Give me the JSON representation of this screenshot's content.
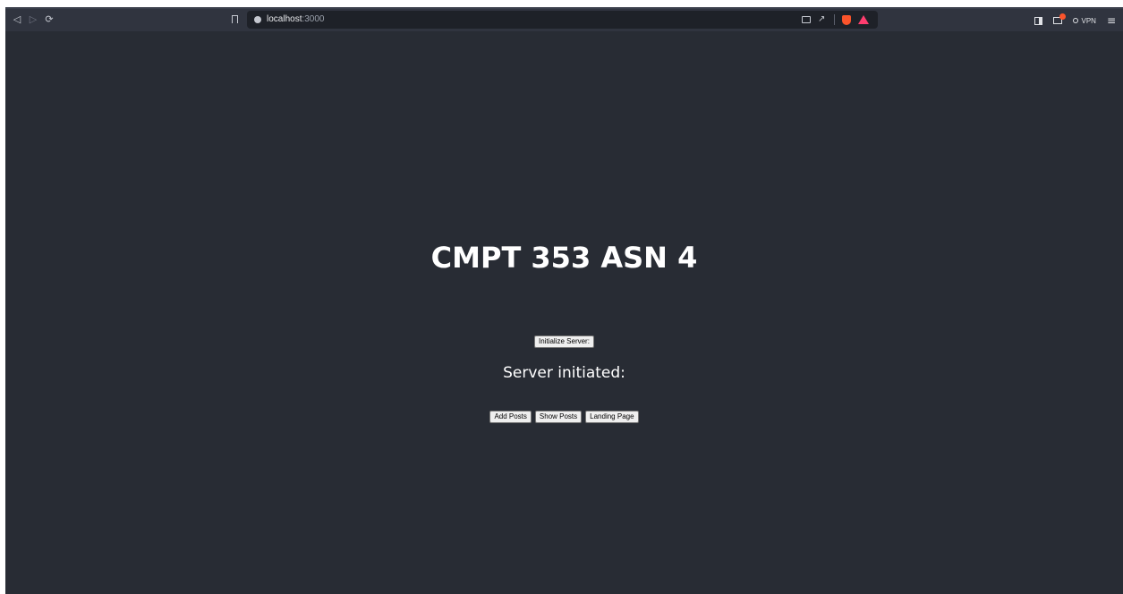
{
  "browser": {
    "url_host": "localhost",
    "url_port": ":3000",
    "vpn_label": "VPN",
    "icons": {
      "back": "back-arrow-icon",
      "forward": "forward-arrow-icon",
      "reload": "reload-icon",
      "bookmark": "bookmark-icon",
      "site_info": "site-info-icon",
      "cast": "cast-icon",
      "share": "share-icon",
      "brave_shield": "brave-shield-icon",
      "brave_rewards": "brave-rewards-icon",
      "sidebar": "sidebar-icon",
      "wallet": "wallet-icon",
      "menu": "menu-icon"
    },
    "colors": {
      "toolbar": "#30343f",
      "urlbar": "#1e2128",
      "page_background": "#282c34",
      "brave_orange": "#fb542b"
    }
  },
  "page": {
    "title": "CMPT 353 ASN 4",
    "init_button": "Initialize Server:",
    "status": "Server initiated:",
    "buttons": {
      "add_posts": "Add Posts",
      "show_posts": "Show Posts",
      "landing_page": "Landing Page"
    }
  }
}
